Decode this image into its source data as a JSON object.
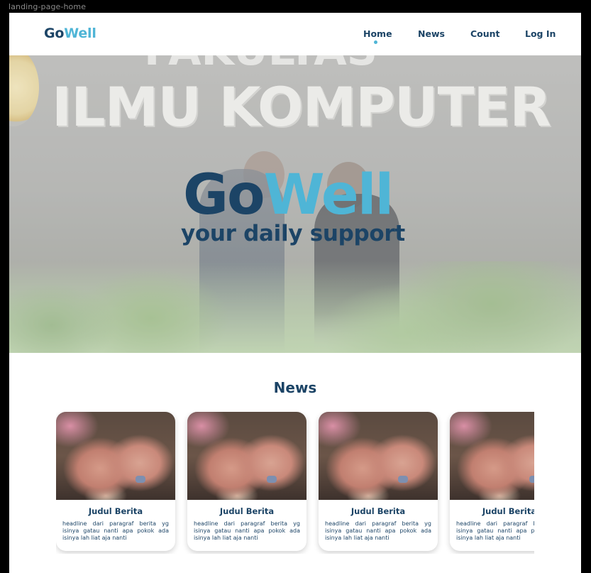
{
  "frame_label": "landing-page-home",
  "brand": {
    "part1": "Go",
    "part2": "Well"
  },
  "nav": {
    "items": [
      {
        "label": "Home",
        "active": true
      },
      {
        "label": "News",
        "active": false
      },
      {
        "label": "Count",
        "active": false
      },
      {
        "label": "Log In",
        "active": false
      }
    ]
  },
  "hero": {
    "title_part1": "Go",
    "title_part2": "Well",
    "tagline": "your daily support",
    "background_text": "ILMU KOMPUTER",
    "background_text_top": "FAKULTAS"
  },
  "news": {
    "heading": "News",
    "cards": [
      {
        "title": "Judul Berita",
        "desc": "headline dari paragraf berita yg isinya gatau nanti apa pokok ada isinya lah liat aja nanti"
      },
      {
        "title": "Judul Berita",
        "desc": "headline dari paragraf berita yg isinya gatau nanti apa pokok ada isinya lah liat aja nanti"
      },
      {
        "title": "Judul Berita",
        "desc": "headline dari paragraf berita yg isinya gatau nanti apa pokok ada isinya lah liat aja nanti"
      },
      {
        "title": "Judul Berita",
        "desc": "headline dari paragraf berita yg isinya gatau nanti apa pokok ada isinya lah liat aja nanti"
      }
    ]
  },
  "colors": {
    "primary": "#1c4466",
    "accent": "#4fb5d6"
  }
}
